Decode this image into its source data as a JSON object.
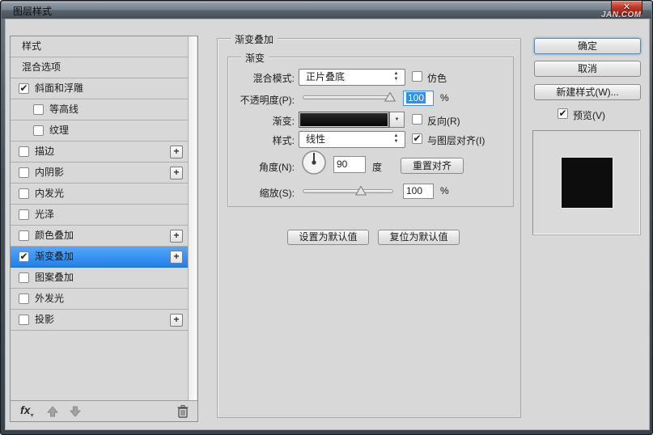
{
  "window": {
    "title": "图层样式",
    "watermark": "JAN.COM"
  },
  "icons": {
    "close": "✕",
    "plus": "+",
    "check": "✔",
    "stepper_up": "▲",
    "stepper_down": "▼",
    "dropdown_arrow": "▼",
    "fx": "fx",
    "fx_caret": "▾"
  },
  "colors": {
    "selection": "#2f8ef4",
    "selection_light": "#55a7f9",
    "gradient_swatch": "#0d0d0d",
    "close_red": "#c0392b"
  },
  "sidebar": {
    "items": [
      {
        "label": "样式",
        "checkbox": false,
        "checked": false,
        "indent": false,
        "plus": false,
        "selected": false
      },
      {
        "label": "混合选项",
        "checkbox": false,
        "checked": false,
        "indent": false,
        "plus": false,
        "selected": false
      },
      {
        "label": "斜面和浮雕",
        "checkbox": true,
        "checked": true,
        "indent": false,
        "plus": false,
        "selected": false
      },
      {
        "label": "等高线",
        "checkbox": true,
        "checked": false,
        "indent": true,
        "plus": false,
        "selected": false
      },
      {
        "label": "纹理",
        "checkbox": true,
        "checked": false,
        "indent": true,
        "plus": false,
        "selected": false
      },
      {
        "label": "描边",
        "checkbox": true,
        "checked": false,
        "indent": false,
        "plus": true,
        "selected": false
      },
      {
        "label": "内阴影",
        "checkbox": true,
        "checked": false,
        "indent": false,
        "plus": true,
        "selected": false
      },
      {
        "label": "内发光",
        "checkbox": true,
        "checked": false,
        "indent": false,
        "plus": false,
        "selected": false
      },
      {
        "label": "光泽",
        "checkbox": true,
        "checked": false,
        "indent": false,
        "plus": false,
        "selected": false
      },
      {
        "label": "颜色叠加",
        "checkbox": true,
        "checked": false,
        "indent": false,
        "plus": true,
        "selected": false
      },
      {
        "label": "渐变叠加",
        "checkbox": true,
        "checked": true,
        "indent": false,
        "plus": true,
        "selected": true
      },
      {
        "label": "图案叠加",
        "checkbox": true,
        "checked": false,
        "indent": false,
        "plus": false,
        "selected": false
      },
      {
        "label": "外发光",
        "checkbox": true,
        "checked": false,
        "indent": false,
        "plus": false,
        "selected": false
      },
      {
        "label": "投影",
        "checkbox": true,
        "checked": false,
        "indent": false,
        "plus": true,
        "selected": false
      }
    ]
  },
  "main": {
    "group_title": "渐变叠加",
    "subgroup_title": "渐变",
    "blend_mode": {
      "label": "混合模式:",
      "value": "正片叠底",
      "dither_label": "仿色",
      "dither_checked": false
    },
    "opacity": {
      "label": "不透明度(P):",
      "value": "100",
      "unit": "%"
    },
    "gradient": {
      "label": "渐变:",
      "reverse_label": "反向(R)",
      "reverse_checked": false
    },
    "style": {
      "label": "样式:",
      "value": "线性",
      "align_label": "与图层对齐(I)",
      "align_checked": true
    },
    "angle": {
      "label": "角度(N):",
      "value": "90",
      "unit": "度",
      "reset_button": "重置对齐"
    },
    "scale": {
      "label": "缩放(S):",
      "value": "100",
      "unit": "%"
    },
    "buttons": {
      "set_default": "设置为默认值",
      "reset_default": "复位为默认值"
    }
  },
  "actions": {
    "ok": "确定",
    "cancel": "取消",
    "new_style": "新建样式(W)...",
    "preview_label": "预览(V)",
    "preview_checked": true
  }
}
